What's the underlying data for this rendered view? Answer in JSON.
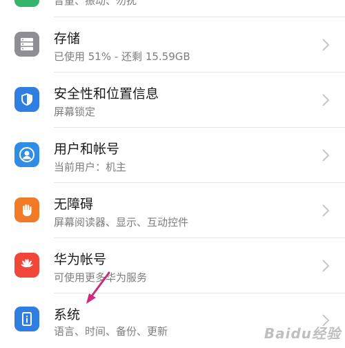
{
  "colors": {
    "storage": "#8e8e93",
    "security": "#2f7ee0",
    "users": "#2f8de3",
    "accessibility": "#f07a25",
    "huawei": "#f0473a",
    "system": "#2f7ee0",
    "arrow": "#d0287a"
  },
  "top_partial": {
    "subtitle": "音量、振动、勿扰",
    "icon": "sound-icon"
  },
  "items": [
    {
      "title": "存储",
      "subtitle": "已使用 51% - 还剩 15.59GB",
      "icon": "storage-icon"
    },
    {
      "title": "安全性和位置信息",
      "subtitle": "屏幕锁定",
      "icon": "shield-icon"
    },
    {
      "title": "用户和帐号",
      "subtitle": "当前用户：机主",
      "icon": "user-icon"
    },
    {
      "title": "无障碍",
      "subtitle": "屏幕阅读器、显示、互动控件",
      "icon": "hand-icon"
    },
    {
      "title": "华为帐号",
      "subtitle": "可使用更多华为服务",
      "icon": "huawei-icon"
    },
    {
      "title": "系统",
      "subtitle": "语言、时间、备份、更新",
      "icon": "system-info-icon"
    }
  ],
  "watermark": "Baidu经验"
}
